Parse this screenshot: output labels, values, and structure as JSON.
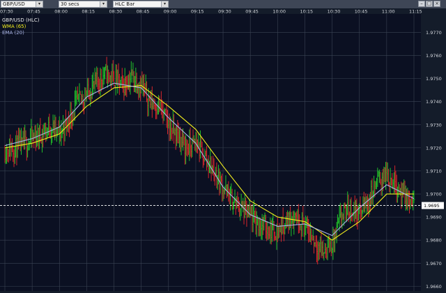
{
  "toolbar": {
    "symbol": "GBP/USD",
    "interval": "30 secs",
    "chart_style": "HLC Bar"
  },
  "chart_data": {
    "type": "line",
    "title": "",
    "xlabel": "",
    "ylabel": "",
    "ylim": [
      1.9658,
      1.9778
    ],
    "y_ticks": [
      1.966,
      1.967,
      1.968,
      1.969,
      1.97,
      1.971,
      1.972,
      1.973,
      1.974,
      1.975,
      1.976,
      1.977
    ],
    "x_ticks": [
      "07:30",
      "07:45",
      "08:00",
      "08:15",
      "08:30",
      "08:45",
      "09:00",
      "09:15",
      "09:30",
      "09:45",
      "10:00",
      "10:15",
      "10:30",
      "10:45",
      "11:00",
      "11:15"
    ],
    "legend": [
      "GBP/USD (HLC)",
      "WMA (65)",
      "EMA (20)"
    ],
    "legend_placement": "top-left",
    "grid": true,
    "current_price_label": "1.9695",
    "current_price": 1.9695,
    "colors": {
      "up": "#22c32a",
      "down": "#d8262b",
      "wma": "#f2ee1e",
      "ema": "#a9b3e6",
      "background": "#0b1022",
      "grid": "#3b4454"
    },
    "price_path": [
      [
        "07:30",
        1.9719
      ],
      [
        "07:35",
        1.972
      ],
      [
        "07:40",
        1.9721
      ],
      [
        "07:45",
        1.9724
      ],
      [
        "07:50",
        1.9726
      ],
      [
        "07:55",
        1.9729
      ],
      [
        "08:00",
        1.9726
      ],
      [
        "08:05",
        1.9732
      ],
      [
        "08:10",
        1.974
      ],
      [
        "08:15",
        1.9743
      ],
      [
        "08:20",
        1.9748
      ],
      [
        "08:25",
        1.9752
      ],
      [
        "08:30",
        1.975
      ],
      [
        "08:35",
        1.9747
      ],
      [
        "08:40",
        1.9751
      ],
      [
        "08:45",
        1.9747
      ],
      [
        "08:50",
        1.974
      ],
      [
        "08:55",
        1.9738
      ],
      [
        "09:00",
        1.973
      ],
      [
        "09:05",
        1.9725
      ],
      [
        "09:10",
        1.972
      ],
      [
        "09:15",
        1.9722
      ],
      [
        "09:20",
        1.9716
      ],
      [
        "09:25",
        1.971
      ],
      [
        "09:30",
        1.9703
      ],
      [
        "09:35",
        1.9697
      ],
      [
        "09:40",
        1.9694
      ],
      [
        "09:45",
        1.969
      ],
      [
        "09:50",
        1.9687
      ],
      [
        "09:55",
        1.9685
      ],
      [
        "10:00",
        1.9684
      ],
      [
        "10:05",
        1.9688
      ],
      [
        "10:10",
        1.9691
      ],
      [
        "10:15",
        1.9686
      ],
      [
        "10:20",
        1.968
      ],
      [
        "10:25",
        1.9675
      ],
      [
        "10:30",
        1.9678
      ],
      [
        "10:35",
        1.969
      ],
      [
        "10:40",
        1.9694
      ],
      [
        "10:45",
        1.9692
      ],
      [
        "10:50",
        1.9697
      ],
      [
        "10:55",
        1.9706
      ],
      [
        "11:00",
        1.9708
      ],
      [
        "11:05",
        1.9705
      ],
      [
        "11:10",
        1.9698
      ],
      [
        "11:15",
        1.9695
      ]
    ],
    "series": [
      {
        "name": "WMA (65)",
        "points": [
          [
            "07:30",
            1.972
          ],
          [
            "07:45",
            1.9722
          ],
          [
            "08:00",
            1.9726
          ],
          [
            "08:15",
            1.9738
          ],
          [
            "08:30",
            1.9746
          ],
          [
            "08:45",
            1.9747
          ],
          [
            "09:00",
            1.9738
          ],
          [
            "09:15",
            1.9728
          ],
          [
            "09:30",
            1.9712
          ],
          [
            "09:45",
            1.9697
          ],
          [
            "10:00",
            1.969
          ],
          [
            "10:15",
            1.9688
          ],
          [
            "10:30",
            1.968
          ],
          [
            "10:45",
            1.9688
          ],
          [
            "11:00",
            1.97
          ],
          [
            "11:15",
            1.97
          ]
        ]
      },
      {
        "name": "EMA (20)",
        "points": [
          [
            "07:30",
            1.9721
          ],
          [
            "07:45",
            1.9724
          ],
          [
            "08:00",
            1.9729
          ],
          [
            "08:15",
            1.9742
          ],
          [
            "08:30",
            1.9748
          ],
          [
            "08:45",
            1.9746
          ],
          [
            "09:00",
            1.9733
          ],
          [
            "09:15",
            1.9722
          ],
          [
            "09:30",
            1.9703
          ],
          [
            "09:45",
            1.9691
          ],
          [
            "10:00",
            1.9686
          ],
          [
            "10:15",
            1.9687
          ],
          [
            "10:30",
            1.9682
          ],
          [
            "10:45",
            1.9694
          ],
          [
            "11:00",
            1.9704
          ],
          [
            "11:15",
            1.9698
          ]
        ]
      }
    ]
  }
}
